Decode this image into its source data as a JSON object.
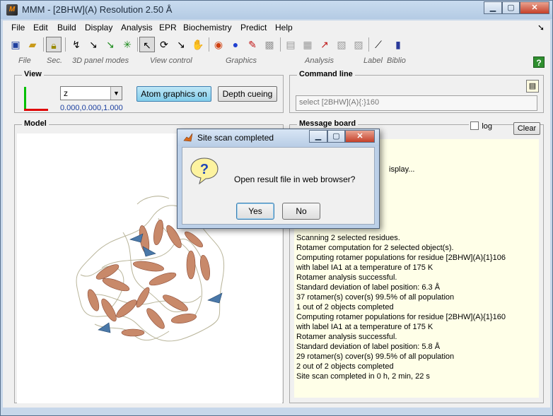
{
  "window": {
    "title": "MMM - [2BHW](A) Resolution 2.50 Å",
    "app_icon_letter": "M",
    "controls": [
      "▁",
      "▢",
      "✕"
    ]
  },
  "menu": [
    "File",
    "Edit",
    "Build",
    "Display",
    "Analysis",
    "EPR",
    "Biochemistry",
    "Predict",
    "Help"
  ],
  "toolbar_groups": [
    "File",
    "Sec.",
    "3D panel modes",
    "View control",
    "Graphics",
    "Analysis",
    "Label",
    "Biblio"
  ],
  "help_label": "?",
  "view": {
    "title": "View",
    "axis_select": "z",
    "vector": "0.000,0.000,1.000",
    "atom_graphics_label": "Atom graphics on",
    "depth_cueing_label": "Depth cueing"
  },
  "command_line": {
    "title": "Command line",
    "value": "select [2BHW](A){:}160"
  },
  "model": {
    "title": "Model"
  },
  "message_board": {
    "title": "Message board",
    "log_label": "log",
    "clear_label": "Clear",
    "lines": [
      "Scanning 2 selected residues.",
      "Rotamer computation for 2 selected object(s).",
      "Computing rotamer populations for residue [2BHW](A){1}106",
      "with label IA1 at a temperature of 175 K",
      "Rotamer analysis successful.",
      "Standard deviation of label position: 6.3 Å",
      "37 rotamer(s) cover(s) 99.5% of all population",
      "1 out of 2 objects completed",
      "Computing rotamer populations for residue [2BHW](A){1}160",
      "with label IA1 at a temperature of 175 K",
      "Rotamer analysis successful.",
      "Standard deviation of label position: 5.8 Å",
      "29 rotamer(s) cover(s) 99.5% of all population",
      "2 out of 2 objects completed",
      "Site scan completed in 0 h, 2 min, 22 s"
    ],
    "partial_hidden_text": "isplay..."
  },
  "dialog": {
    "title": "Site scan completed",
    "message": "Open result file in web browser?",
    "yes_label": "Yes",
    "no_label": "No",
    "icon_glyph": "?"
  }
}
